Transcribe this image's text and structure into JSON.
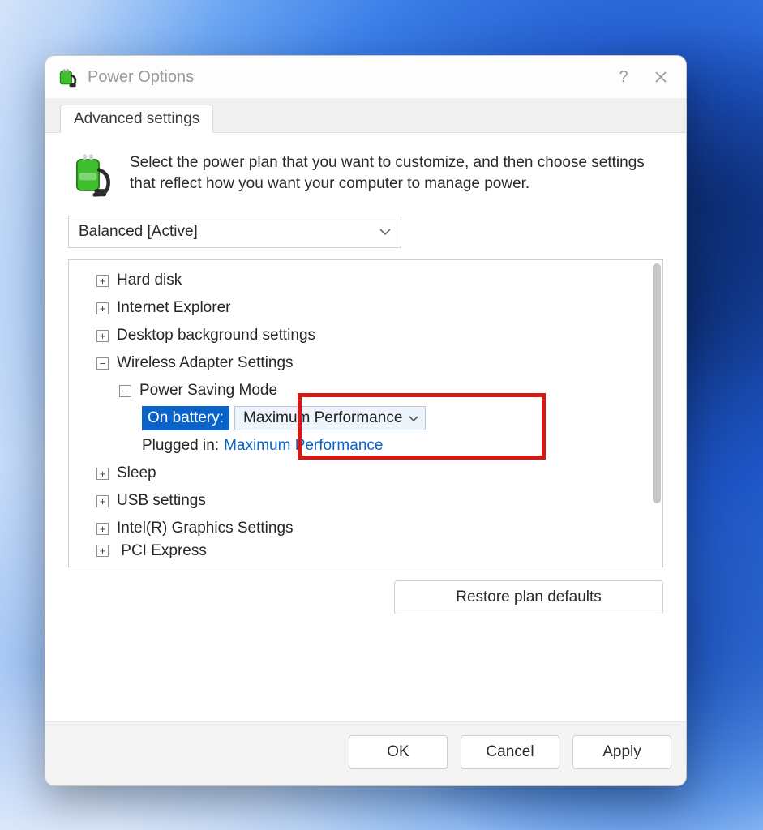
{
  "window": {
    "title": "Power Options",
    "tab": "Advanced settings",
    "description": "Select the power plan that you want to customize, and then choose settings that reflect how you want your computer to manage power."
  },
  "plan": {
    "selected": "Balanced [Active]"
  },
  "tree": {
    "hard_disk": "Hard disk",
    "ie": "Internet Explorer",
    "desktop_bg": "Desktop background settings",
    "wireless": "Wireless Adapter Settings",
    "power_saving_mode": "Power Saving Mode",
    "on_battery_label": "On battery:",
    "on_battery_value": "Maximum Performance",
    "plugged_in_label": "Plugged in:",
    "plugged_in_value": "Maximum Performance",
    "sleep": "Sleep",
    "usb": "USB settings",
    "intel_gfx": "Intel(R) Graphics Settings",
    "pci": "PCI Express"
  },
  "buttons": {
    "restore": "Restore plan defaults",
    "ok": "OK",
    "cancel": "Cancel",
    "apply": "Apply"
  }
}
